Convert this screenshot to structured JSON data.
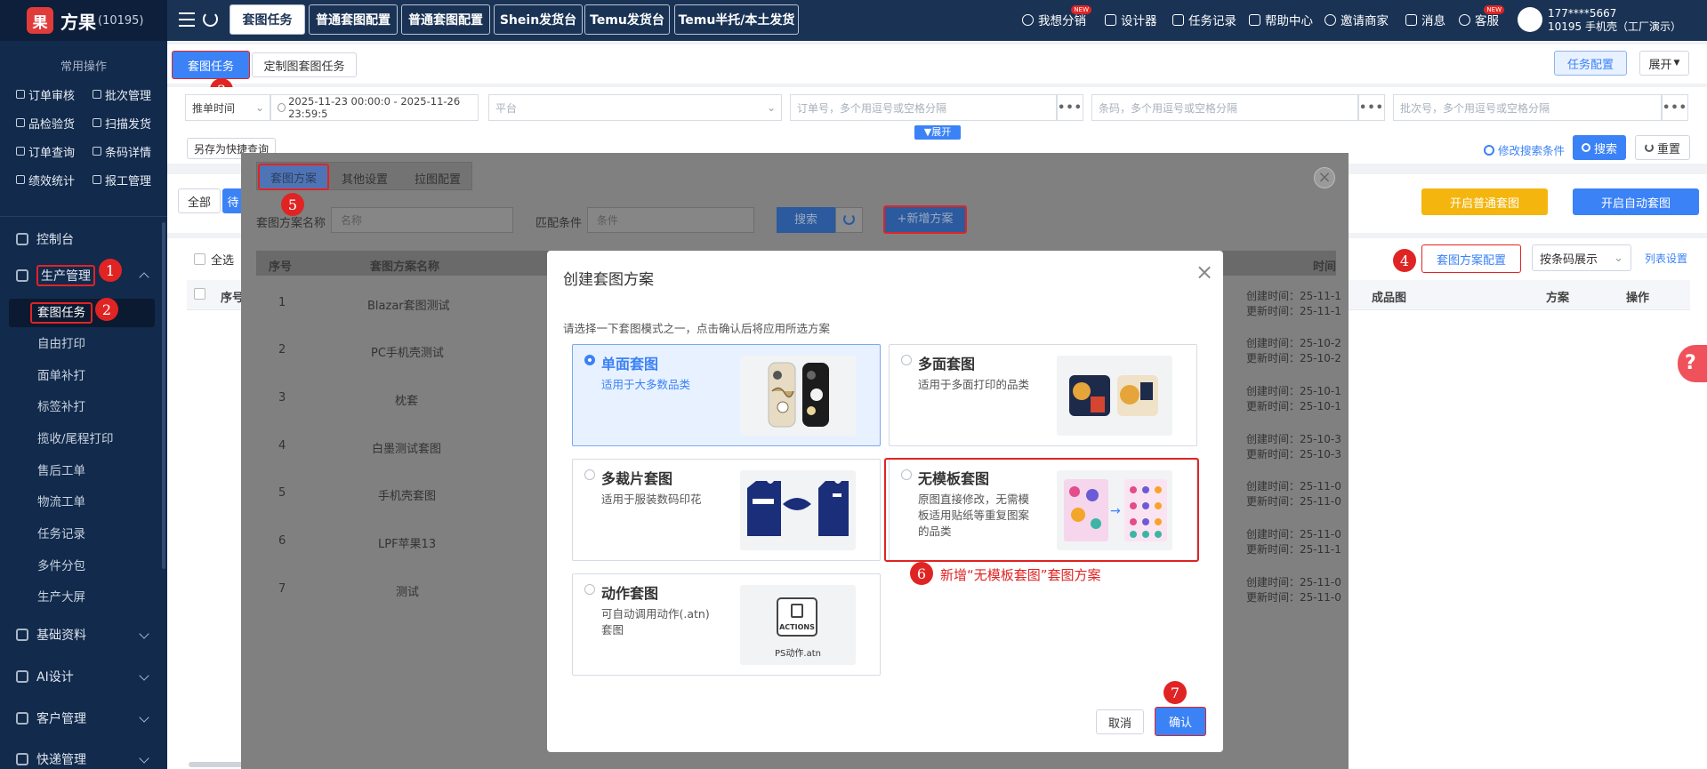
{
  "app": {
    "name": "方果",
    "id": "(10195)",
    "logo_letter": "果"
  },
  "sidebar": {
    "quick_title": "常用操作",
    "quick_ops": [
      "订单审核",
      "批次管理",
      "品检验货",
      "扫描发货",
      "订单查询",
      "条码详情",
      "绩效统计",
      "报工管理"
    ],
    "nav": [
      {
        "label": "控制台"
      },
      {
        "label": "生产管理"
      },
      {
        "label": "基础资料"
      },
      {
        "label": "AI设计"
      },
      {
        "label": "客户管理"
      },
      {
        "label": "快递管理"
      }
    ],
    "sub_items": [
      "套图任务",
      "自由打印",
      "面单补打",
      "标签补打",
      "揽收/尾程打印",
      "售后工单",
      "物流工单",
      "任务记录",
      "多件分包",
      "生产大屏"
    ]
  },
  "topbar": {
    "tabs": [
      "套图任务",
      "普通套图配置",
      "普通套图配置",
      "Shein发货台",
      "Temu发货台",
      "Temu半托/本土发货"
    ],
    "links": [
      "我想分销",
      "设计器",
      "任务记录",
      "帮助中心",
      "邀请商家",
      "消息",
      "客服"
    ],
    "new_badge": "NEW",
    "user_phone": "177****5667",
    "user_shop": "10195 手机壳（工厂演示）"
  },
  "content": {
    "tabs": [
      "套图任务",
      "定制图套图任务"
    ],
    "task_config": "任务配置",
    "expand": "展开",
    "time_select": "推单时间",
    "date_range": "2025-11-23 00:00:0 - 2025-11-26 23:59:5",
    "platform_placeholder": "平台",
    "order_placeholder": "订单号，多个用逗号或空格分隔",
    "barcode_placeholder": "条码，多个用逗号或空格分隔",
    "batch_placeholder": "批次号，多个用逗号或空格分隔",
    "more": "•••",
    "expand_toggle": "展开",
    "save_quick": "另存为快捷查询",
    "modify_cond": "修改搜索条件",
    "search": "搜索",
    "reset": "重置",
    "filter_all": "全部",
    "filter_second": "待",
    "open_normal": "开启普通套图",
    "open_auto": "开启自动套图",
    "select_all": "全选",
    "scheme_config": "套图方案配置",
    "barcode_display": "按条码展示",
    "column_setting": "列表设置",
    "col_seq": "序号",
    "col_product": "成品图",
    "col_scheme": "方案",
    "col_op": "操作"
  },
  "overlay": {
    "tabs": [
      "套图方案",
      "其他设置",
      "拉图配置"
    ],
    "name_label": "套图方案名称",
    "name_placeholder": "名称",
    "match_label": "匹配条件",
    "match_placeholder": "条件",
    "search": "搜索",
    "add_scheme": "+新增方案",
    "col_seq": "序号",
    "col_name": "套图方案名称",
    "col_time": "时间",
    "rows": [
      {
        "seq": "1",
        "name": "Blazar套图测试",
        "created": "创建时间：25-11-1",
        "updated": "更新时间：25-11-1"
      },
      {
        "seq": "2",
        "name": "PC手机壳测试",
        "created": "创建时间：25-10-2",
        "updated": "更新时间：25-10-2"
      },
      {
        "seq": "3",
        "name": "枕套",
        "created": "创建时间：25-10-1",
        "updated": "更新时间：25-10-1"
      },
      {
        "seq": "4",
        "name": "白墨测试套图",
        "created": "创建时间：25-10-3",
        "updated": "更新时间：25-10-3"
      },
      {
        "seq": "5",
        "name": "手机壳套图",
        "created": "创建时间：25-11-0",
        "updated": "更新时间：25-11-0"
      },
      {
        "seq": "6",
        "name": "LPF苹果13",
        "created": "创建时间：25-11-0",
        "updated": "更新时间：25-11-1"
      },
      {
        "seq": "7",
        "name": "测试",
        "created": "创建时间：25-11-0",
        "updated": "更新时间：25-11-0"
      }
    ]
  },
  "dialog": {
    "title": "创建套图方案",
    "hint": "请选择一下套图模式之一，点击确认后将应用所选方案",
    "options": [
      {
        "title": "单面套图",
        "desc": "适用于大多数品类"
      },
      {
        "title": "多面套图",
        "desc": "适用于多面打印的品类"
      },
      {
        "title": "多裁片套图",
        "desc": "适用于服装数码印花"
      },
      {
        "title": "无模板套图",
        "desc": "原图直接修改，无需模板适用贴纸等重复图案的品类"
      },
      {
        "title": "动作套图",
        "desc": "可自动调用动作(.atn)套图"
      }
    ],
    "actions_label": "ACTIONS",
    "atn_label": "PS动作.atn",
    "cancel": "取消",
    "confirm": "确认"
  },
  "annotations": {
    "note6": "新增“无模板套图”套图方案",
    "numbers": [
      "1",
      "2",
      "3",
      "4",
      "5",
      "6",
      "7"
    ]
  },
  "colors": {
    "accent": "#3b82f6",
    "highlight": "#e02424",
    "sidebar": "#122a4b",
    "topbar": "#1a3355",
    "warning": "#f5b50f"
  }
}
